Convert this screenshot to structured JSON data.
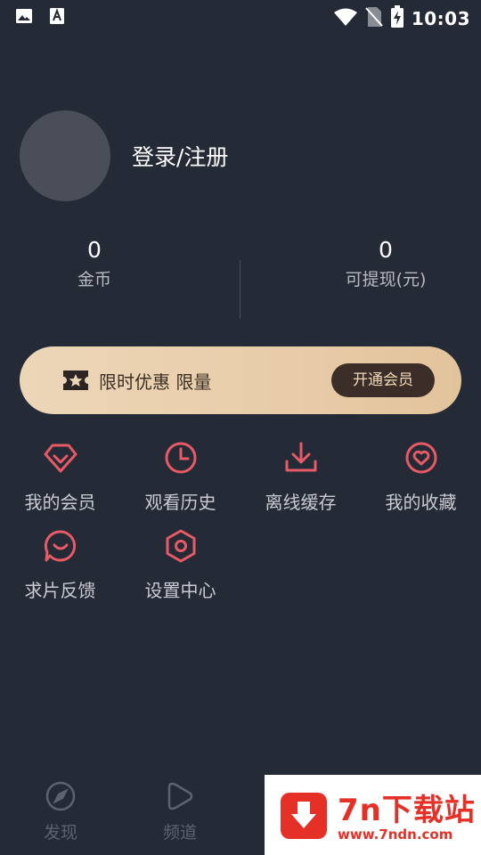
{
  "status_bar": {
    "time": "10:03",
    "icons": [
      "image-icon",
      "font-icon",
      "wifi-icon",
      "no-sim-icon",
      "battery-charging-icon"
    ]
  },
  "profile": {
    "login_label": "登录/注册"
  },
  "stats": {
    "coins": {
      "value": "0",
      "label": "金币"
    },
    "withdrawable": {
      "value": "0",
      "label": "可提现(元)"
    }
  },
  "vip_banner": {
    "promo_text": "限时优惠 限量",
    "button_label": "开通会员"
  },
  "menu": [
    {
      "label": "我的会员",
      "icon": "diamond-icon"
    },
    {
      "label": "观看历史",
      "icon": "clock-icon"
    },
    {
      "label": "离线缓存",
      "icon": "download-icon"
    },
    {
      "label": "我的收藏",
      "icon": "heart-icon"
    },
    {
      "label": "求片反馈",
      "icon": "feedback-icon"
    },
    {
      "label": "设置中心",
      "icon": "settings-icon"
    }
  ],
  "tabbar": [
    {
      "label": "发现",
      "icon": "compass-icon"
    },
    {
      "label": "频道",
      "icon": "play-icon"
    }
  ],
  "watermark": {
    "title": "7n下载站",
    "url": "www.7ndn.com"
  },
  "colors": {
    "background": "#252a37",
    "accent": "#e85a66",
    "vip_gold": "#ecd6b8"
  }
}
